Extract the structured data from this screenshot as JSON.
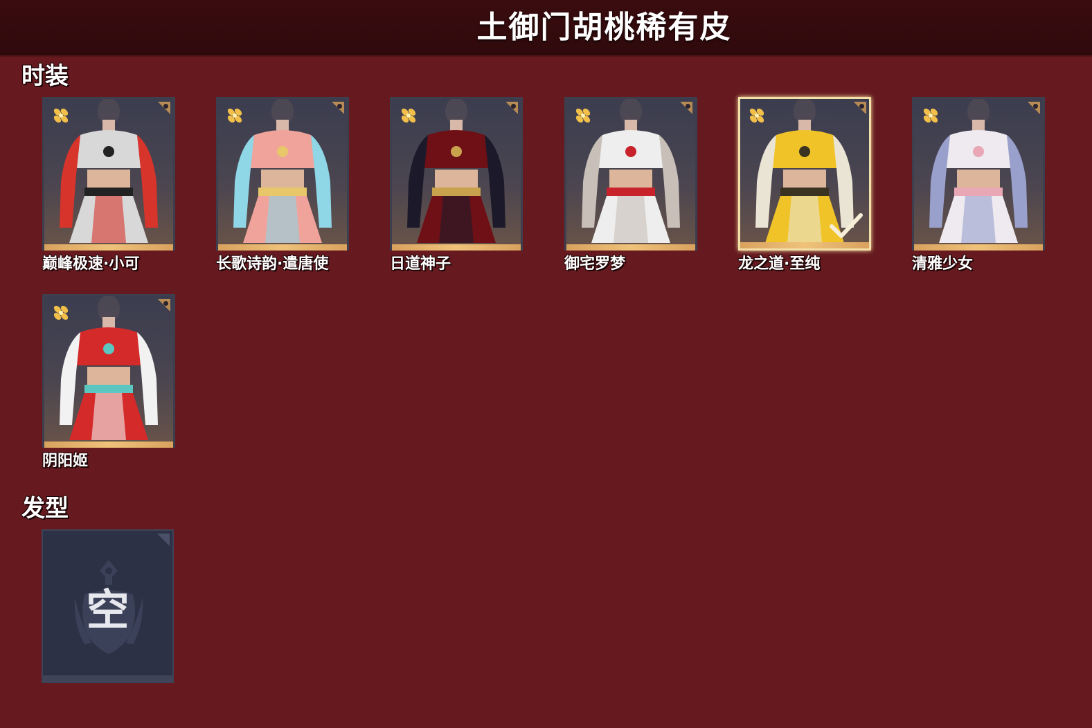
{
  "header": {
    "title": "土御门胡桃稀有皮"
  },
  "sections": {
    "fashion": {
      "title": "时装",
      "items": [
        {
          "name": "巅峰极速·小可",
          "selected": false,
          "palette": {
            "primary": "#d8d8d8",
            "secondary": "#d7342b",
            "accent": "#222222"
          }
        },
        {
          "name": "长歌诗韵·遣唐使",
          "selected": false,
          "palette": {
            "primary": "#f0a39a",
            "secondary": "#8fd6e6",
            "accent": "#e8c66a"
          }
        },
        {
          "name": "日道神子",
          "selected": false,
          "palette": {
            "primary": "#6e1016",
            "secondary": "#1c1a2a",
            "accent": "#c9a24e"
          }
        },
        {
          "name": "御宅罗梦",
          "selected": false,
          "palette": {
            "primary": "#eeeeee",
            "secondary": "#c8c0b8",
            "accent": "#c8232b"
          }
        },
        {
          "name": "龙之道·至纯",
          "selected": true,
          "palette": {
            "primary": "#f0c428",
            "secondary": "#eae4d4",
            "accent": "#3a3322"
          }
        },
        {
          "name": "清雅少女",
          "selected": false,
          "palette": {
            "primary": "#eeeaf0",
            "secondary": "#9aa0cc",
            "accent": "#e9a7b6"
          }
        },
        {
          "name": "阴阳姬",
          "selected": false,
          "palette": {
            "primary": "#d42a2a",
            "secondary": "#f2f2f2",
            "accent": "#5cc6c0"
          }
        }
      ]
    },
    "hair": {
      "title": "发型",
      "empty_label": "空"
    }
  },
  "colors": {
    "background": "#661a1f",
    "header_background": "#320b0e",
    "card_gold_strip": "#e6b06a",
    "selected_border": "#f3dfa8",
    "empty_card_background": "#2c3146"
  },
  "icons": {
    "rarity": "gold-flower-icon",
    "selected": "checkmark-icon",
    "corner": "corner-ornament-icon",
    "empty_emblem": "shield-emblem-icon"
  }
}
